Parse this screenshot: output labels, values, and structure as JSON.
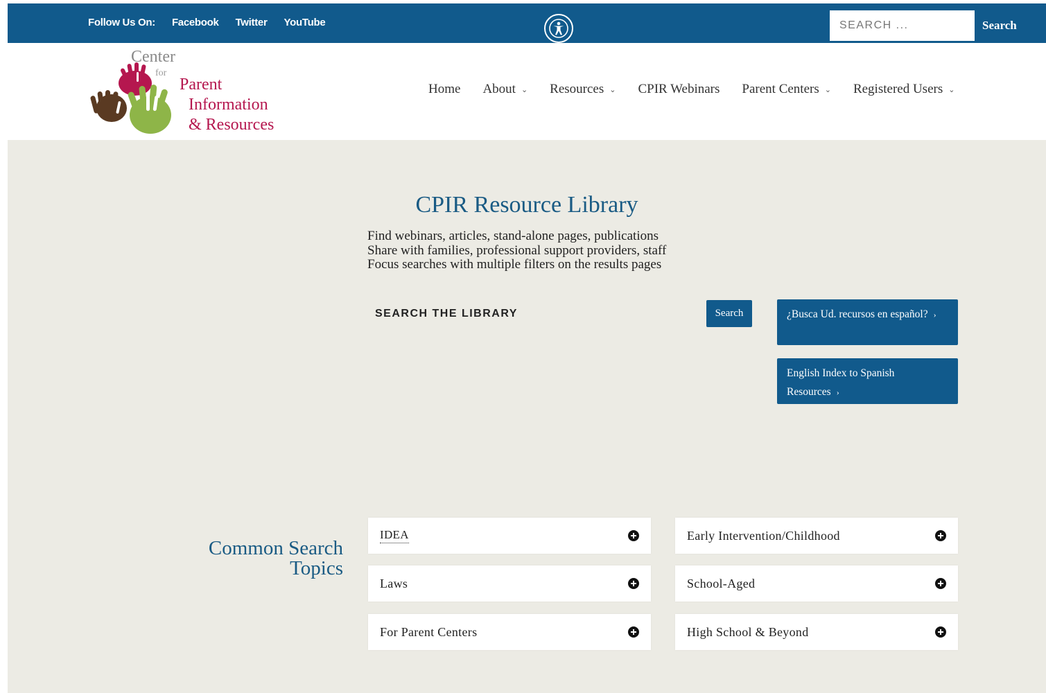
{
  "topbar": {
    "follow_label": "Follow Us On:",
    "social": [
      "Facebook",
      "Twitter",
      "YouTube"
    ],
    "search_placeholder": "SEARCH ...",
    "search_button": "Search"
  },
  "logo": {
    "line1": "Center",
    "line_for": "for",
    "line2": "Parent",
    "line3": "Information",
    "line4": "& Resources"
  },
  "nav": {
    "items": [
      {
        "label": "Home",
        "has_dropdown": false
      },
      {
        "label": "About",
        "has_dropdown": true
      },
      {
        "label": "Resources",
        "has_dropdown": true
      },
      {
        "label": "CPIR Webinars",
        "has_dropdown": false
      },
      {
        "label": "Parent Centers",
        "has_dropdown": true
      },
      {
        "label": "Registered Users",
        "has_dropdown": true
      }
    ]
  },
  "library": {
    "title": "CPIR Resource Library",
    "intro": [
      "Find webinars, articles, stand-alone pages, publications",
      "Share with families, professional support providers, staff",
      "Focus searches with multiple filters on the results pages"
    ],
    "search_placeholder": "SEARCH THE LIBRARY",
    "search_button": "Search",
    "spanish_btn_1": "¿Busca Ud. recursos en español?",
    "spanish_btn_2": "English Index to Spanish Resources",
    "arrow": "›"
  },
  "common": {
    "title": "Common Search Topics",
    "left_topics": [
      "IDEA",
      "Laws",
      "For Parent Centers"
    ],
    "right_topics": [
      "Early Intervention/Childhood",
      "School-Aged",
      "High School & Beyond"
    ]
  },
  "colors": {
    "primary_blue": "#115a8c",
    "title_blue": "#1a5b84",
    "background": "#ecebe4",
    "logo_magenta": "#b5174f",
    "logo_green": "#8eb548",
    "logo_brown": "#5a3a22"
  },
  "icons": {
    "accessibility": "accessibility-icon",
    "dropdown": "chevron-down-icon",
    "expand": "plus-circle-icon"
  }
}
